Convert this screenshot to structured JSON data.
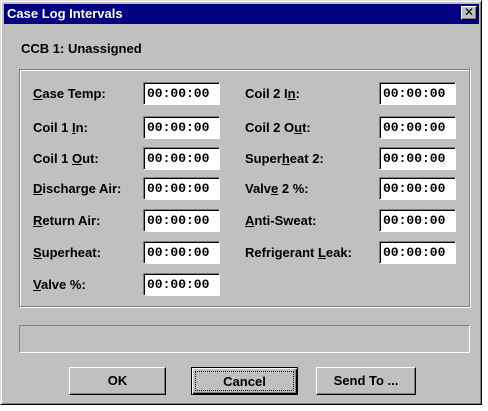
{
  "window": {
    "title": "Case Log Intervals",
    "close_glyph": "✕"
  },
  "ccb_label": "CCB 1: Unassigned",
  "left_rows": [
    {
      "pre": "",
      "ul": "C",
      "post": "ase Temp:",
      "value": "00:00:00"
    },
    {
      "pre": "Coil 1 ",
      "ul": "I",
      "post": "n:",
      "value": "00:00:00"
    },
    {
      "pre": "Coil 1 ",
      "ul": "O",
      "post": "ut:",
      "value": "00:00:00"
    },
    {
      "pre": "",
      "ul": "D",
      "post": "ischarge Air:",
      "value": "00:00:00"
    },
    {
      "pre": "",
      "ul": "R",
      "post": "eturn Air:",
      "value": "00:00:00"
    },
    {
      "pre": "",
      "ul": "S",
      "post": "uperheat:",
      "value": "00:00:00"
    },
    {
      "pre": "",
      "ul": "V",
      "post": "alve %:",
      "value": "00:00:00"
    }
  ],
  "right_rows": [
    {
      "pre": "Coil 2 I",
      "ul": "n",
      "post": ":",
      "value": "00:00:00"
    },
    {
      "pre": "Coil 2 O",
      "ul": "u",
      "post": "t:",
      "value": "00:00:00"
    },
    {
      "pre": "Super",
      "ul": "h",
      "post": "eat 2:",
      "value": "00:00:00"
    },
    {
      "pre": "Valv",
      "ul": "e",
      "post": " 2 %:",
      "value": "00:00:00"
    },
    {
      "pre": "",
      "ul": "A",
      "post": "nti-Sweat:",
      "value": "00:00:00"
    },
    {
      "pre": "Refrigerant ",
      "ul": "L",
      "post": "eak:",
      "value": "00:00:00"
    }
  ],
  "buttons": {
    "ok": "OK",
    "cancel": "Cancel",
    "send_to": "Send To ..."
  }
}
